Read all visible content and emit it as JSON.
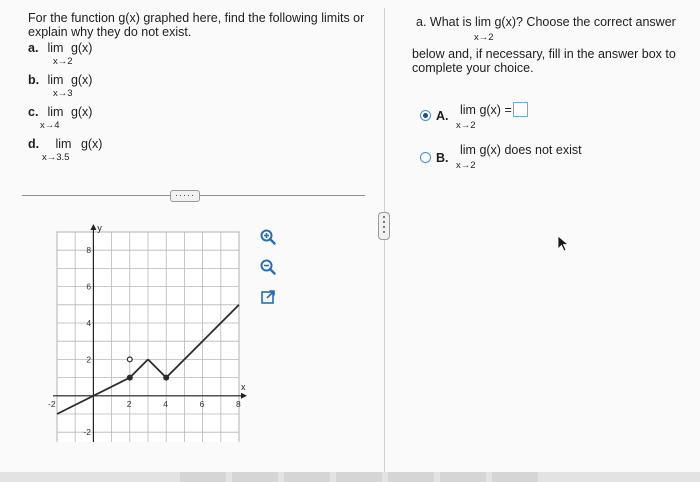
{
  "question": {
    "intro": "For the function g(x) graphed here, find the following limits or explain why they do not exist.",
    "parts": [
      {
        "label": "a.",
        "lim": "lim",
        "sub": "x→2",
        "fn": "g(x)"
      },
      {
        "label": "b.",
        "lim": "lim",
        "sub": "x→3",
        "fn": "g(x)"
      },
      {
        "label": "c.",
        "lim": "lim",
        "sub": "x→4",
        "fn": "g(x)"
      },
      {
        "label": "d.",
        "lim": "lim",
        "sub": "x→3.5",
        "fn": "g(x)"
      }
    ],
    "expand_label": "·····"
  },
  "answer_panel": {
    "prompt_part1": "a. What is  lim g(x)? Choose the correct answer",
    "prompt_sub": "x→2",
    "prompt_part2": "below and, if necessary, fill in the answer box to complete your choice.",
    "options": [
      {
        "letter": "A.",
        "text": "lim g(x) =",
        "sub": "x→2",
        "selected": true
      },
      {
        "letter": "B.",
        "text": "lim g(x) does not exist",
        "sub": "x→2",
        "selected": false
      }
    ]
  },
  "graph": {
    "y_axis_label": "y",
    "x_axis_label": "x",
    "x_ticks": [
      "-2",
      "2",
      "4",
      "6",
      "8"
    ],
    "y_ticks": [
      "8",
      "6",
      "4",
      "2",
      "-2"
    ],
    "x_range": [
      -2,
      8
    ],
    "y_range": [
      -3,
      9
    ],
    "segments": [
      {
        "from": [
          -2,
          -1
        ],
        "to": [
          2,
          1
        ]
      },
      {
        "from": [
          2,
          1
        ],
        "to": [
          3,
          2
        ]
      },
      {
        "from": [
          3,
          2
        ],
        "to": [
          4,
          1
        ]
      },
      {
        "from": [
          4,
          1
        ],
        "to": [
          8,
          5
        ]
      }
    ],
    "points": [
      {
        "x": 2,
        "y": 1,
        "filled": true
      },
      {
        "x": 2,
        "y": 2,
        "filled": false
      },
      {
        "x": 4,
        "y": 1,
        "filled": true
      }
    ]
  },
  "tools": [
    "zoom-in-icon",
    "zoom-out-icon",
    "open-external-icon"
  ],
  "colors": {
    "accent": "#4a8fd0",
    "selected": "#1f4f8a",
    "graph_line": "#2b2b2b"
  }
}
